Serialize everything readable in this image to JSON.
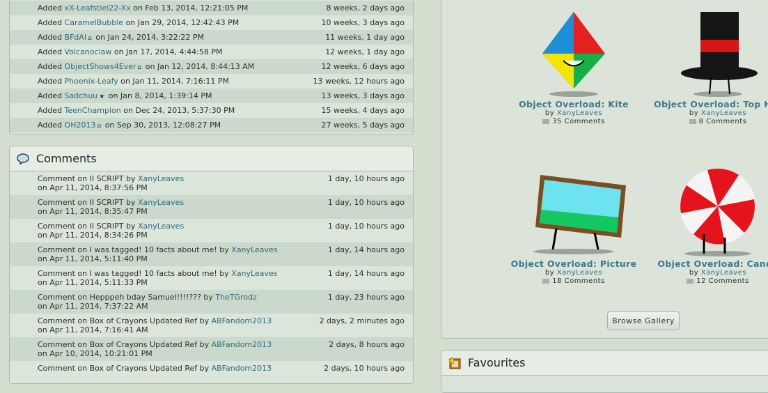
{
  "watchers": [
    {
      "pre": "Added",
      "user": "xX-Leafstiel22-Xx",
      "badge": "",
      "date": "on Feb 13, 2014, 12:21:05 PM",
      "ago": "8 weeks, 2 days ago"
    },
    {
      "pre": "Added",
      "user": "CaramelBubble",
      "badge": "",
      "date": "on Jan 29, 2014, 12:42:43 PM",
      "ago": "10 weeks, 3 days ago"
    },
    {
      "pre": "Added",
      "user": "BFdAI",
      "badge": "⌂",
      "date": "on Jan 24, 2014, 3:22:22 PM",
      "ago": "11 weeks, 1 day ago"
    },
    {
      "pre": "Added",
      "user": "Volcanoclaw",
      "badge": "",
      "date": "on Jan 17, 2014, 4:44:58 PM",
      "ago": "12 weeks, 1 day ago"
    },
    {
      "pre": "Added",
      "user": "ObjectShows4Ever",
      "badge": "⌂",
      "date": "on Jan 12, 2014, 8:44:13 AM",
      "ago": "12 weeks, 6 days ago"
    },
    {
      "pre": "Added",
      "user": "Phoenix-Leafy",
      "badge": "",
      "date": "on Jan 11, 2014, 7:16:11 PM",
      "ago": "13 weeks, 12 hours ago"
    },
    {
      "pre": "Added",
      "user": "Sadchuu",
      "badge": "★",
      "date": "on Jan 8, 2014, 1:39:14 PM",
      "ago": "13 weeks, 3 days ago"
    },
    {
      "pre": "Added",
      "user": "TeenChampion",
      "badge": "",
      "date": "on Dec 24, 2013, 5:37:30 PM",
      "ago": "15 weeks, 4 days ago"
    },
    {
      "pre": "Added",
      "user": "OH2013",
      "badge": "⌂",
      "date": "on Sep 30, 2013, 12:08:27 PM",
      "ago": "27 weeks, 5 days ago"
    }
  ],
  "comments": {
    "title": "Comments",
    "rows": [
      {
        "text": "Comment on II SCRIPT by",
        "user": "XanyLeaves",
        "date": "on Apr 11, 2014, 8:37:56 PM",
        "ago": "1 day, 10 hours ago"
      },
      {
        "text": "Comment on II SCRIPT by",
        "user": "XanyLeaves",
        "date": "on Apr 11, 2014, 8:35:47 PM",
        "ago": "1 day, 10 hours ago"
      },
      {
        "text": "Comment on II SCRIPT by",
        "user": "XanyLeaves",
        "date": "on Apr 11, 2014, 8:34:26 PM",
        "ago": "1 day, 10 hours ago"
      },
      {
        "text": "Comment on I was tagged! 10 facts about me! by",
        "user": "XanyLeaves",
        "date": "on Apr 11, 2014, 5:11:40 PM",
        "ago": "1 day, 14 hours ago"
      },
      {
        "text": "Comment on I was tagged! 10 facts about me! by",
        "user": "XanyLeaves",
        "date": "on Apr 11, 2014, 5:11:33 PM",
        "ago": "1 day, 14 hours ago"
      },
      {
        "text": "Comment on Hepppeh bday Samuel!!!!??? by",
        "user": "TheTGrodz",
        "date": "on Apr 11, 2014, 7:37:22 AM",
        "ago": "1 day, 23 hours ago"
      },
      {
        "text": "Comment on Box of Crayons Updated Ref by",
        "user": "ABFandom2013",
        "date": "on Apr 11, 2014, 7:16:41 AM",
        "ago": "2 days, 2 minutes ago"
      },
      {
        "text": "Comment on Box of Crayons Updated Ref by",
        "user": "ABFandom2013",
        "date": "on Apr 10, 2014, 10:21:01 PM",
        "ago": "2 days, 8 hours ago"
      },
      {
        "text": "Comment on Box of Crayons Updated Ref by",
        "user": "ABFandom2013",
        "date": "",
        "ago": "2 days, 10 hours ago"
      }
    ]
  },
  "gallery": {
    "items": [
      {
        "title": "Object Overload: Kite",
        "by": "by",
        "author": "XanyLeaves",
        "comments": "35 Comments"
      },
      {
        "title": "Object Overload: Top Hat",
        "by": "by",
        "author": "XanyLeaves",
        "comments": "8 Comments"
      },
      {
        "title": "Object Overload: Picture",
        "by": "by",
        "author": "XanyLeaves",
        "comments": "18 Comments"
      },
      {
        "title": "Object Overload: Candy",
        "by": "by",
        "author": "XanyLeaves",
        "comments": "12 Comments"
      }
    ],
    "browse": "Browse Gallery"
  },
  "favourites": {
    "title": "Favourites"
  }
}
